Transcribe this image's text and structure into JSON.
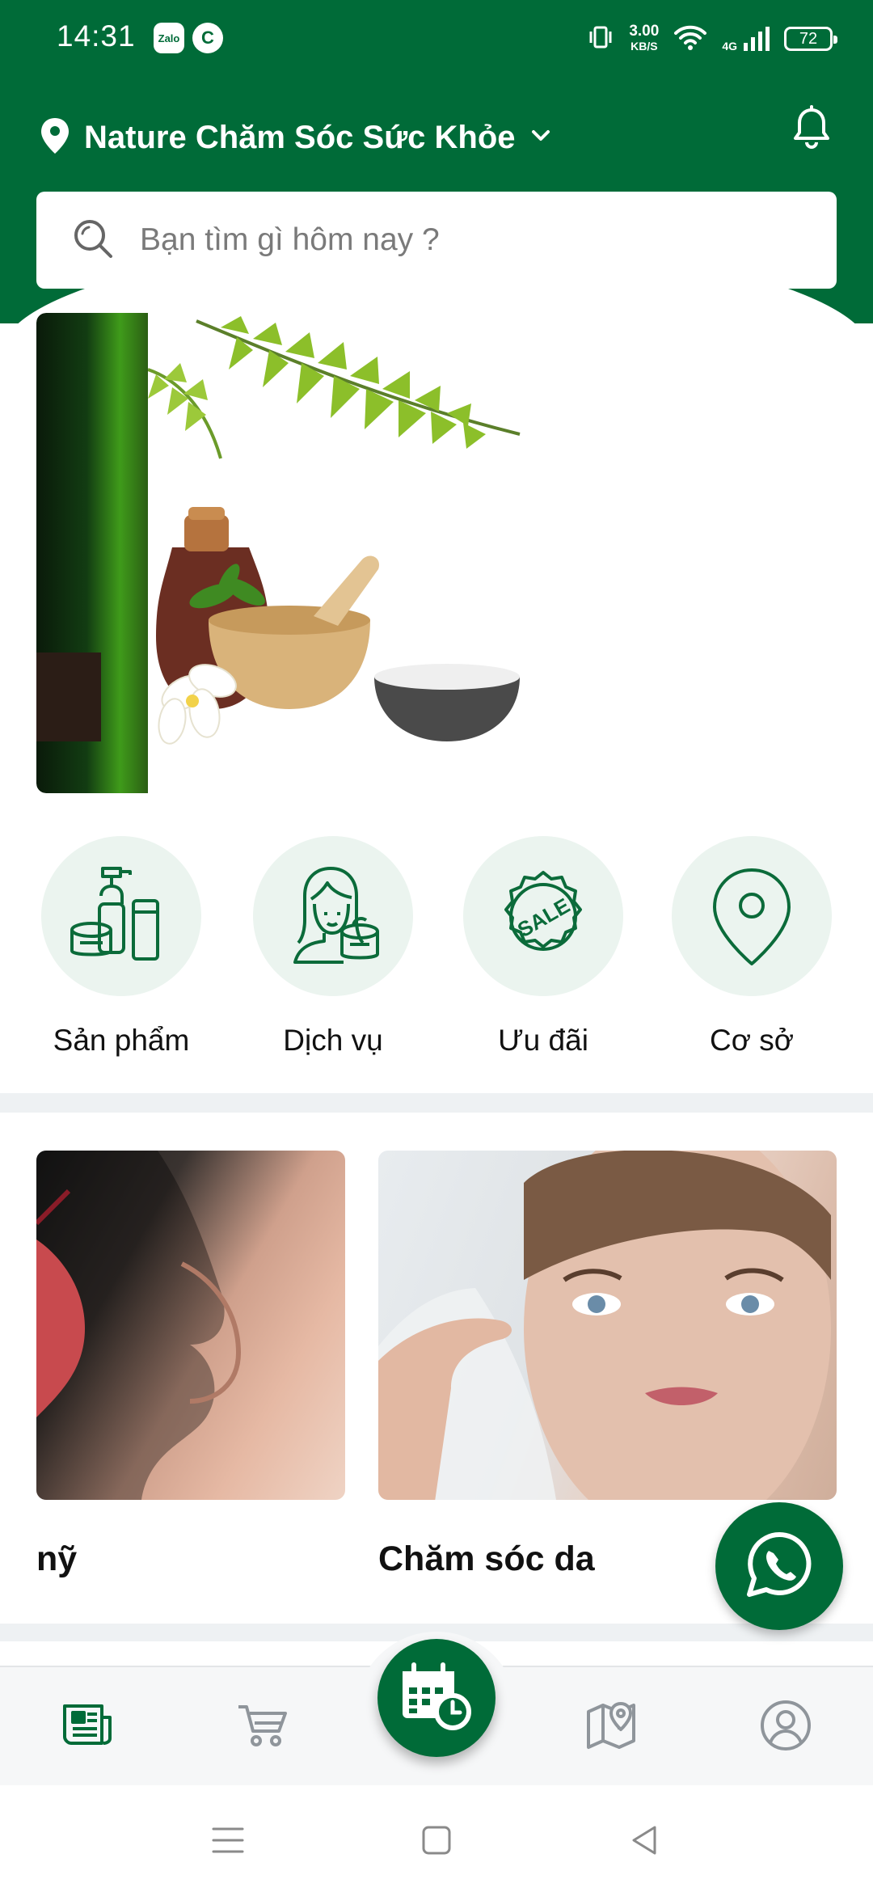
{
  "status_bar": {
    "time": "14:31",
    "apps": [
      "Zalo",
      "C"
    ],
    "net_speed_value": "3.00",
    "net_speed_unit": "KB/S",
    "network": "4G",
    "battery": "72"
  },
  "header": {
    "location_title": "Nature Chăm Sóc Sức Khỏe",
    "icons": [
      "location-pin-icon",
      "chevron-down-icon",
      "bell-icon"
    ]
  },
  "search": {
    "placeholder": "Bạn tìm gì hôm nay ?"
  },
  "categories": [
    {
      "label": "Sản phẩm",
      "icon": "products-icon"
    },
    {
      "label": "Dịch vụ",
      "icon": "beauty-service-icon"
    },
    {
      "label": "Ưu đãi",
      "icon": "sale-badge-icon"
    },
    {
      "label": "Cơ sở",
      "icon": "location-icon"
    }
  ],
  "services": [
    {
      "label": "nỹ"
    },
    {
      "label": "Chăm sóc da"
    }
  ],
  "bottom_nav": [
    "news-icon",
    "cart-icon",
    "calendar-clock-icon",
    "map-icon",
    "profile-icon"
  ],
  "colors": {
    "brand": "#006b38",
    "category_bg": "#ebf4ef"
  }
}
